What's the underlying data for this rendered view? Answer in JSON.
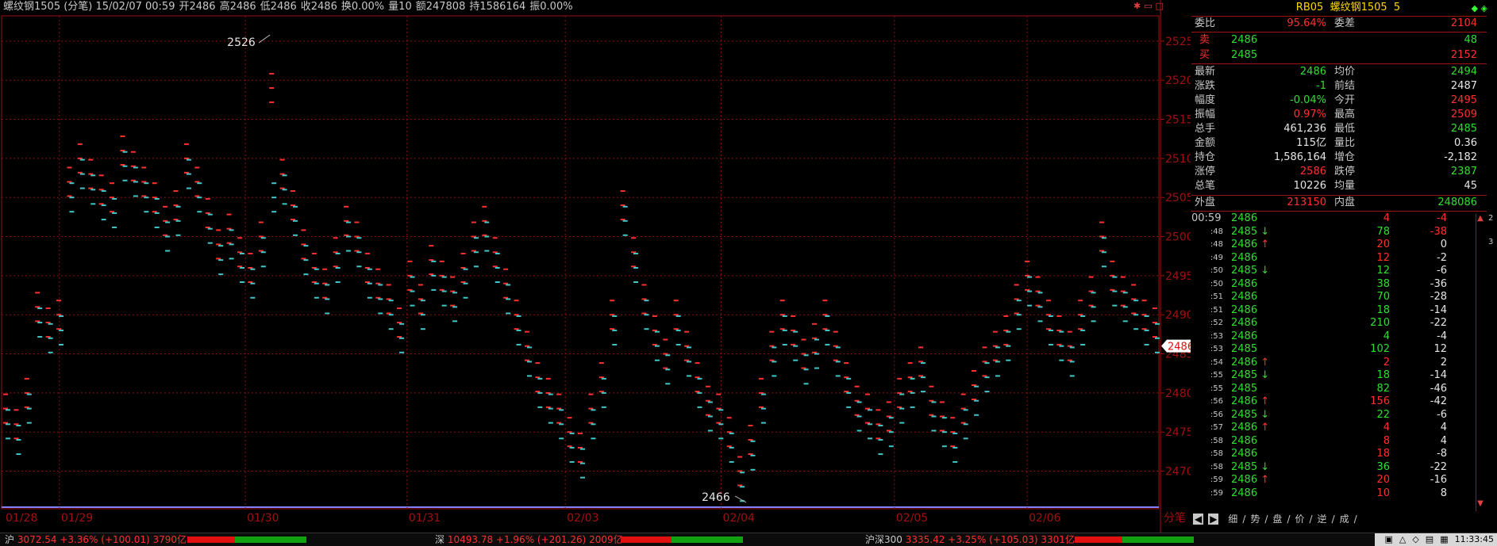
{
  "info_bar": {
    "title": "螺纹钢1505 (分笔) 15/02/07 00:59",
    "open": "开2486",
    "high": "高2486",
    "low": "低2486",
    "close": "收2486",
    "change_rate": "换0.00%",
    "volume": "量10",
    "amount": "额247808",
    "hold": "持1586164",
    "amplitude": "振0.00%"
  },
  "chart_data": {
    "type": "scatter",
    "title": "",
    "xlabel": "",
    "ylabel": "",
    "ylim": [
      2466,
      2526
    ],
    "y_ticks": [
      2470,
      2475,
      2480,
      2485,
      2490,
      2495,
      2500,
      2505,
      2510,
      2515,
      2520,
      2525
    ],
    "y_tick_labels": [
      "2470",
      "2475",
      "2480",
      "2485",
      "2490",
      "2495",
      "2500",
      "2505",
      "2510",
      "2515",
      "2520",
      "2525"
    ],
    "x_tick_labels": [
      "01/28",
      "01/29",
      "01/30",
      "01/31",
      "02/03",
      "02/04",
      "02/05",
      "02/06",
      "分笔"
    ],
    "high_label": "2526",
    "low_label": "2466",
    "current_price_label": "2486",
    "grid": true,
    "series": [
      {
        "color": "#ff3030",
        "values": [
          2478,
          2476,
          2480,
          2491,
          2489,
          2490,
          2507,
          2510,
          2508,
          2506,
          2505,
          2511,
          2509,
          2507,
          2505,
          2502,
          2504,
          2510,
          2507,
          2503,
          2499,
          2501,
          2498,
          2496,
          2500,
          2519,
          2508,
          2504,
          2499,
          2496,
          2494,
          2498,
          2502,
          2500,
          2496,
          2494,
          2492,
          2489,
          2495,
          2492,
          2497,
          2495,
          2493,
          2496,
          2500,
          2502,
          2498,
          2494,
          2490,
          2486,
          2482,
          2480,
          2478,
          2475,
          2473,
          2478,
          2482,
          2490,
          2504,
          2498,
          2492,
          2488,
          2485,
          2490,
          2486,
          2482,
          2479,
          2478,
          2475,
          2470,
          2474,
          2480,
          2486,
          2490,
          2488,
          2485,
          2487,
          2490,
          2486,
          2482,
          2479,
          2478,
          2476,
          2477,
          2480,
          2482,
          2484,
          2479,
          2477,
          2475,
          2478,
          2481,
          2484,
          2486,
          2488,
          2492,
          2495,
          2493,
          2490,
          2488,
          2486,
          2490,
          2493,
          2500,
          2495,
          2493,
          2492,
          2490,
          2489
        ]
      },
      {
        "color": "#40c8c8",
        "values": [
          2476,
          2474,
          2478,
          2489,
          2487,
          2488,
          2505,
          2508,
          2506,
          2504,
          2503,
          2509,
          2507,
          2505,
          2503,
          2500,
          2502,
          2508,
          2505,
          2501,
          2497,
          2499,
          2496,
          2494,
          2498,
          2505,
          2506,
          2502,
          2497,
          2494,
          2492,
          2496,
          2500,
          2498,
          2494,
          2492,
          2490,
          2487,
          2493,
          2490,
          2495,
          2493,
          2491,
          2494,
          2498,
          2500,
          2496,
          2492,
          2488,
          2484,
          2480,
          2478,
          2476,
          2473,
          2471,
          2476,
          2480,
          2488,
          2502,
          2496,
          2490,
          2486,
          2483,
          2488,
          2484,
          2480,
          2477,
          2476,
          2473,
          2468,
          2472,
          2478,
          2484,
          2488,
          2486,
          2483,
          2485,
          2488,
          2484,
          2480,
          2477,
          2476,
          2474,
          2475,
          2478,
          2480,
          2482,
          2477,
          2475,
          2473,
          2476,
          2479,
          2482,
          2484,
          2486,
          2490,
          2493,
          2491,
          2488,
          2486,
          2484,
          2488,
          2491,
          2498,
          2493,
          2491,
          2490,
          2488,
          2487
        ]
      }
    ]
  },
  "panel": {
    "code": "RB05",
    "name": "螺纹钢1505",
    "suffix": "5",
    "weibi_label": "委比",
    "weibi_value": "95.64%",
    "weicha_label": "委差",
    "weicha_value": "2104",
    "sell_label": "卖",
    "sell_price": "2486",
    "sell_volume": "48",
    "buy_label": "买",
    "buy_price": "2485",
    "buy_volume": "2152",
    "stats": [
      {
        "l1": "最新",
        "v1": "2486",
        "c1": "green",
        "l2": "均价",
        "v2": "2494",
        "c2": "green"
      },
      {
        "l1": "涨跌",
        "v1": "-1",
        "c1": "green",
        "l2": "前结",
        "v2": "2487",
        "c2": "white"
      },
      {
        "l1": "幅度",
        "v1": "-0.04%",
        "c1": "green",
        "l2": "今开",
        "v2": "2495",
        "c2": "red"
      },
      {
        "l1": "振幅",
        "v1": "0.97%",
        "c1": "red",
        "l2": "最高",
        "v2": "2509",
        "c2": "red"
      },
      {
        "l1": "总手",
        "v1": "461,236",
        "c1": "white",
        "l2": "最低",
        "v2": "2485",
        "c2": "green"
      },
      {
        "l1": "金额",
        "v1": "115亿",
        "c1": "white",
        "l2": "量比",
        "v2": "0.36",
        "c2": "white"
      },
      {
        "l1": "持仓",
        "v1": "1,586,164",
        "c1": "white",
        "l2": "增仓",
        "v2": "-2,182",
        "c2": "white"
      },
      {
        "l1": "涨停",
        "v1": "2586",
        "c1": "red",
        "l2": "跌停",
        "v2": "2387",
        "c2": "green"
      },
      {
        "l1": "总笔",
        "v1": "10226",
        "c1": "white",
        "l2": "均量",
        "v2": "45",
        "c2": "white"
      }
    ],
    "waipan_label": "外盘",
    "waipan_value": "213150",
    "neipan_label": "内盘",
    "neipan_value": "248086",
    "ticks": [
      {
        "t": "00:59",
        "p": "2486",
        "a": "",
        "v": "4",
        "vc": "red",
        "d": "-4",
        "dc": "red"
      },
      {
        "t": ":48",
        "p": "2485",
        "a": "↓",
        "v": "78",
        "vc": "green",
        "d": "-38",
        "dc": "red"
      },
      {
        "t": ":48",
        "p": "2486",
        "a": "↑",
        "v": "20",
        "vc": "red",
        "d": "0",
        "dc": "white"
      },
      {
        "t": ":49",
        "p": "2486",
        "a": "",
        "v": "12",
        "vc": "red",
        "d": "-2",
        "dc": "white"
      },
      {
        "t": ":50",
        "p": "2485",
        "a": "↓",
        "v": "12",
        "vc": "green",
        "d": "-6",
        "dc": "white"
      },
      {
        "t": ":50",
        "p": "2486",
        "a": "",
        "v": "38",
        "vc": "green",
        "d": "-36",
        "dc": "white"
      },
      {
        "t": ":51",
        "p": "2486",
        "a": "",
        "v": "70",
        "vc": "green",
        "d": "-28",
        "dc": "white"
      },
      {
        "t": ":51",
        "p": "2486",
        "a": "",
        "v": "18",
        "vc": "green",
        "d": "-14",
        "dc": "white"
      },
      {
        "t": ":52",
        "p": "2486",
        "a": "",
        "v": "210",
        "vc": "green",
        "d": "-22",
        "dc": "white"
      },
      {
        "t": ":53",
        "p": "2486",
        "a": "",
        "v": "4",
        "vc": "green",
        "d": "-4",
        "dc": "white"
      },
      {
        "t": ":53",
        "p": "2485",
        "a": "",
        "v": "102",
        "vc": "green",
        "d": "12",
        "dc": "white"
      },
      {
        "t": ":54",
        "p": "2486",
        "a": "↑",
        "v": "2",
        "vc": "red",
        "d": "2",
        "dc": "white"
      },
      {
        "t": ":55",
        "p": "2485",
        "a": "↓",
        "v": "18",
        "vc": "green",
        "d": "-14",
        "dc": "white"
      },
      {
        "t": ":55",
        "p": "2485",
        "a": "",
        "v": "82",
        "vc": "green",
        "d": "-46",
        "dc": "white"
      },
      {
        "t": ":56",
        "p": "2486",
        "a": "↑",
        "v": "156",
        "vc": "red",
        "d": "-42",
        "dc": "white"
      },
      {
        "t": ":56",
        "p": "2485",
        "a": "↓",
        "v": "22",
        "vc": "green",
        "d": "-6",
        "dc": "white"
      },
      {
        "t": ":57",
        "p": "2486",
        "a": "↑",
        "v": "4",
        "vc": "red",
        "d": "4",
        "dc": "white"
      },
      {
        "t": ":58",
        "p": "2486",
        "a": "",
        "v": "8",
        "vc": "red",
        "d": "4",
        "dc": "white"
      },
      {
        "t": ":58",
        "p": "2486",
        "a": "",
        "v": "18",
        "vc": "red",
        "d": "-8",
        "dc": "white"
      },
      {
        "t": ":58",
        "p": "2485",
        "a": "↓",
        "v": "36",
        "vc": "green",
        "d": "-22",
        "dc": "white"
      },
      {
        "t": ":59",
        "p": "2486",
        "a": "↑",
        "v": "20",
        "vc": "red",
        "d": "-16",
        "dc": "white"
      },
      {
        "t": ":59",
        "p": "2486",
        "a": "",
        "v": "10",
        "vc": "red",
        "d": "8",
        "dc": "white"
      }
    ],
    "tabs": [
      "细",
      "势",
      "盘",
      "价",
      "逆",
      "成"
    ]
  },
  "status": {
    "sh_name": "沪",
    "sh_value": "3072.54 +3.36% (+100.01) 3790亿",
    "sz_name": "深",
    "sz_value": "10493.78 +1.96% (+201.26) 2009亿",
    "hs300_name": "沪深300",
    "hs300_value": "3335.42 +3.25% (+105.03) 3301亿",
    "time": "11:33:45"
  }
}
